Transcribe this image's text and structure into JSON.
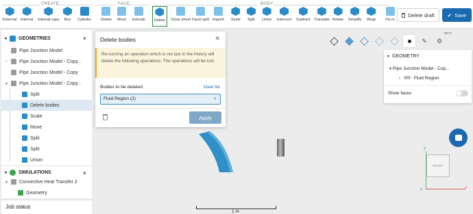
{
  "toolbar": {
    "groups": {
      "create": "CREATE",
      "face": "FACE",
      "body": "BODY"
    },
    "tools": {
      "external": "External",
      "internal": "Internal",
      "internal_caps": "Internal caps",
      "box": "Box",
      "cylinder": "Cylinder",
      "delete": "Delete",
      "move": "Move",
      "extrude": "Extrude",
      "delete_body": "Delete",
      "close_sheet": "Close sheet",
      "facet_split": "Facet split",
      "imprint": "Imprint",
      "scale": "Scale",
      "split": "Split",
      "union": "Union",
      "intersect": "Intersect",
      "subtract": "Subtract",
      "translate": "Translate",
      "rotate": "Rotate",
      "simplify": "Simplify",
      "wrap": "Wrap",
      "fix": "Fix in"
    },
    "delete_draft": "Delete draft",
    "save": "Save"
  },
  "left_panel": {
    "geometries_header": "GEOMETRIES",
    "items": [
      "Pipe Junction Model",
      "Pipe Junction Model - Copy...",
      "Pipe Junction Model - Copy",
      "Pipe Junction Model - Copy..."
    ],
    "ops": [
      "Split",
      "Delete bodies",
      "Scale",
      "Move",
      "Split",
      "Split",
      "Union"
    ],
    "simulations_header": "SIMULATIONS",
    "sim_item": "Convective Heat Transfer 2",
    "sim_child": "Geometry",
    "job_status": "Job status"
  },
  "dialog": {
    "title": "Delete bodies",
    "warning": "Re-running an operation which is not last in the history will delete the following operations. The operations will be lost.",
    "bodies_label": "Bodies to be deleted",
    "clear_list": "Clear list",
    "selected_body": "Fluid Region (2)",
    "apply": "Apply"
  },
  "viewport": {
    "beta": "BETA",
    "scale_label": "1 m",
    "orientation": {
      "front": "FRONT",
      "y": "y",
      "x": "x",
      "z": "z"
    }
  },
  "geometry_panel": {
    "title": "GEOMETRY",
    "model": "Pipe Junction Model - Cop...",
    "region": "Fluid Region",
    "show_faces": "Show faces"
  },
  "colors": {
    "accent": "#1a6ab1",
    "icon": "#2a8bc9",
    "active_tool": "#1d8a3a",
    "warning": "#fcf5dd"
  }
}
